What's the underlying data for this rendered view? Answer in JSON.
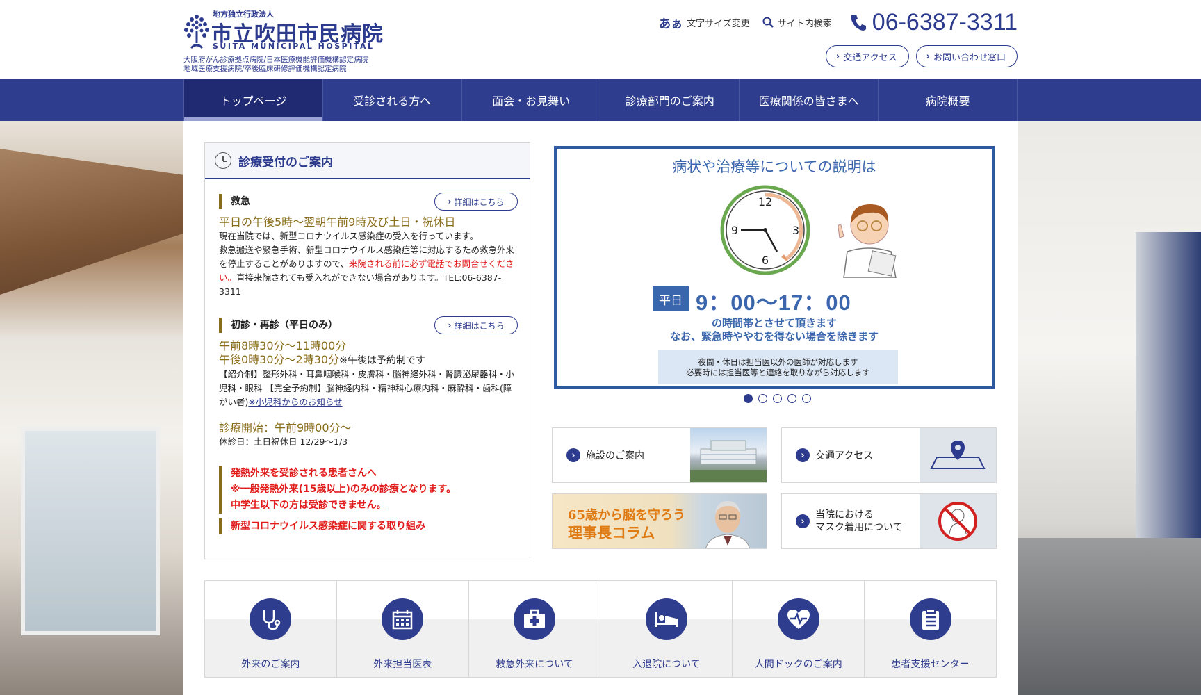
{
  "header": {
    "logo_sub": "地方独立行政法人",
    "logo_name": "市立吹田市民病院",
    "logo_en": "SUITA MUNICIPAL HOSPITAL",
    "cert_line1": "大阪府がん診療拠点病院/日本医療機能評価機構認定病院",
    "cert_line2": "地域医療支援病院/卒後臨床研修評価機構認定病院",
    "font_size_label": "文字サイズ変更",
    "font_size_glyph": "あぁ",
    "search_label": "サイト内検索",
    "phone": "06-6387-3311",
    "access_label": "交通アクセス",
    "contact_label": "お問い合わせ窓口"
  },
  "nav": [
    {
      "label": "トップページ"
    },
    {
      "label": "受診される方へ"
    },
    {
      "label": "面会・お見舞い"
    },
    {
      "label": "診療部門のご案内"
    },
    {
      "label": "医療関係の皆さまへ"
    },
    {
      "label": "病院概要"
    }
  ],
  "reception": {
    "title": "診療受付のご案内",
    "emergency": {
      "label": "救急",
      "detail": "詳細はこちら",
      "hours": "平日の午後5時～翌朝午前9時及び土日・祝休日",
      "covid_notice": "現在当院では、新型コロナウイルス感染症の受入を行っています。",
      "text1": "救急搬送や緊急手術、新型コロナウイルス感染症等に対応するため救急外来を停止することがありますので、",
      "text_red": "来院される前に必ず電話でお問合せください。",
      "text2": "直接来院されても受入れができない場合があります。TEL:06-6387-3311"
    },
    "first_visit": {
      "label": "初診・再診（平日のみ）",
      "detail": "詳細はこちら",
      "am": "午前8時30分～11時00分",
      "pm": "午後0時30分～2時30分",
      "pm_note": "※午後は予約制です",
      "text": "【紹介制】整形外科・耳鼻咽喉科・皮膚科・脳神経外科・腎臓泌尿器科・小児科・眼科 【完全予約制】脳神経内科・精神科心療内科・麻酔科・歯科(障がい者)",
      "link": "※小児科からのお知らせ"
    },
    "start": "診療開始：午前9時00分～",
    "closed": "休診日：土日祝休日 12/29～1/3",
    "fever": [
      "発熱外来を受診される患者さんへ",
      "※一般発熱外来(15歳以上)のみの診療となります。",
      "中学生以下の方は受診できません。"
    ],
    "covid_link": "新型コロナウイルス感染症に関する取り組み"
  },
  "slide": {
    "heading": "病状や治療等についての説明は",
    "weekday": "平日",
    "time": "9：00～17：00",
    "line1": "の時間帯とさせて頂きます",
    "line2": "なお、緊急時ややむを得ない場合を除きます",
    "note1": "夜間・休日は担当医以外の医師が対応します",
    "note2": "必要時には担当医等と連絡を取りながら対応します",
    "clock_12": "12",
    "clock_3": "3",
    "clock_6": "6",
    "clock_9": "9",
    "active_dot": 1,
    "dot_count": 5
  },
  "cards": {
    "facility": "施設のご案内",
    "access": "交通アクセス",
    "column_t1": "65歳から脳を守ろう",
    "column_t2": "理事長コラム",
    "mask_l1": "当院における",
    "mask_l2": "マスク着用について"
  },
  "quick": [
    {
      "label": "外来のご案内",
      "icon": "stethoscope-icon"
    },
    {
      "label": "外来担当医表",
      "icon": "calendar-icon"
    },
    {
      "label": "救急外来について",
      "icon": "first-aid-kit-icon"
    },
    {
      "label": "入退院について",
      "icon": "hospital-bed-icon"
    },
    {
      "label": "人間ドックのご案内",
      "icon": "heart-pulse-icon"
    },
    {
      "label": "患者支援センター",
      "icon": "clipboard-icon"
    }
  ],
  "colors": {
    "brand_navy": "#2f3d8f",
    "accent_gold": "#8a6d1a",
    "alert_red": "#e21b1b",
    "slide_blue": "#3a66ad"
  }
}
